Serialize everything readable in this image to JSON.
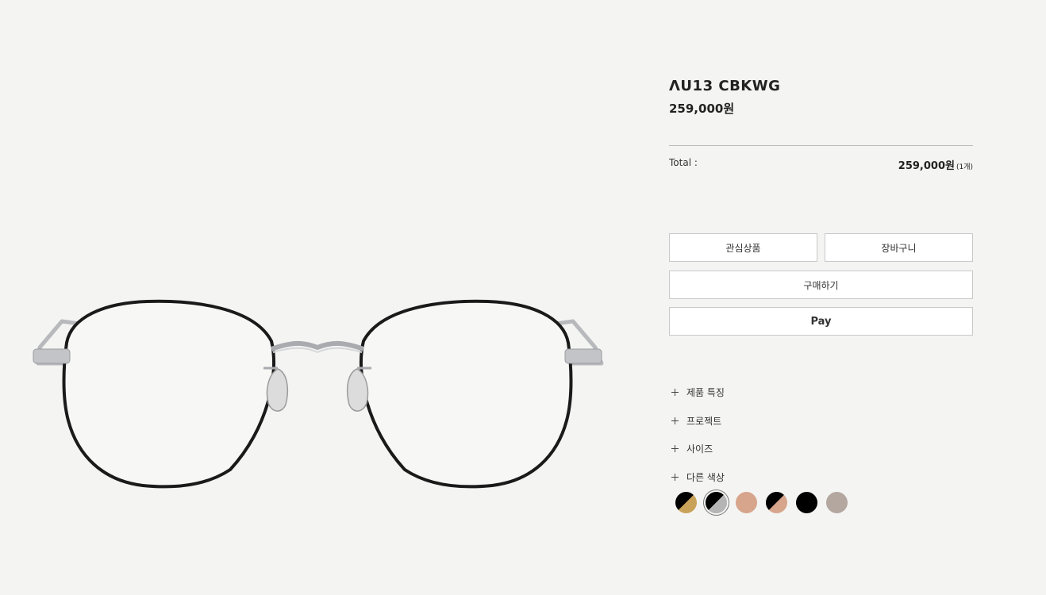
{
  "product": {
    "name": "ΛU13 CBKWG",
    "price": "259,000원"
  },
  "total": {
    "label": "Total :",
    "value": "259,000원",
    "qty": "(1개)"
  },
  "buttons": {
    "wishlist": "관심상품",
    "cart": "장바구니",
    "buy": "구매하기",
    "pay": "Pay"
  },
  "accordion": [
    {
      "label": "제품 특징"
    },
    {
      "label": "프로젝트"
    },
    {
      "label": "사이즈"
    },
    {
      "label": "다른 색상"
    }
  ],
  "colors": {
    "background": "#f4f4f3",
    "button_border": "#c9c9c9",
    "swatches": [
      {
        "name": "black-gold",
        "a": "#000000",
        "b": "#c9a25a"
      },
      {
        "name": "black-silver",
        "a": "#000000",
        "b": "#b5b5b5",
        "selected": true
      },
      {
        "name": "rose-gold",
        "a": "#d7a58c",
        "b": "#d7a58c"
      },
      {
        "name": "black-rose",
        "a": "#000000",
        "b": "#d7a58c"
      },
      {
        "name": "black",
        "a": "#000000",
        "b": "#000000"
      },
      {
        "name": "taupe",
        "a": "#b4a7a0",
        "b": "#b4a7a0"
      }
    ]
  }
}
